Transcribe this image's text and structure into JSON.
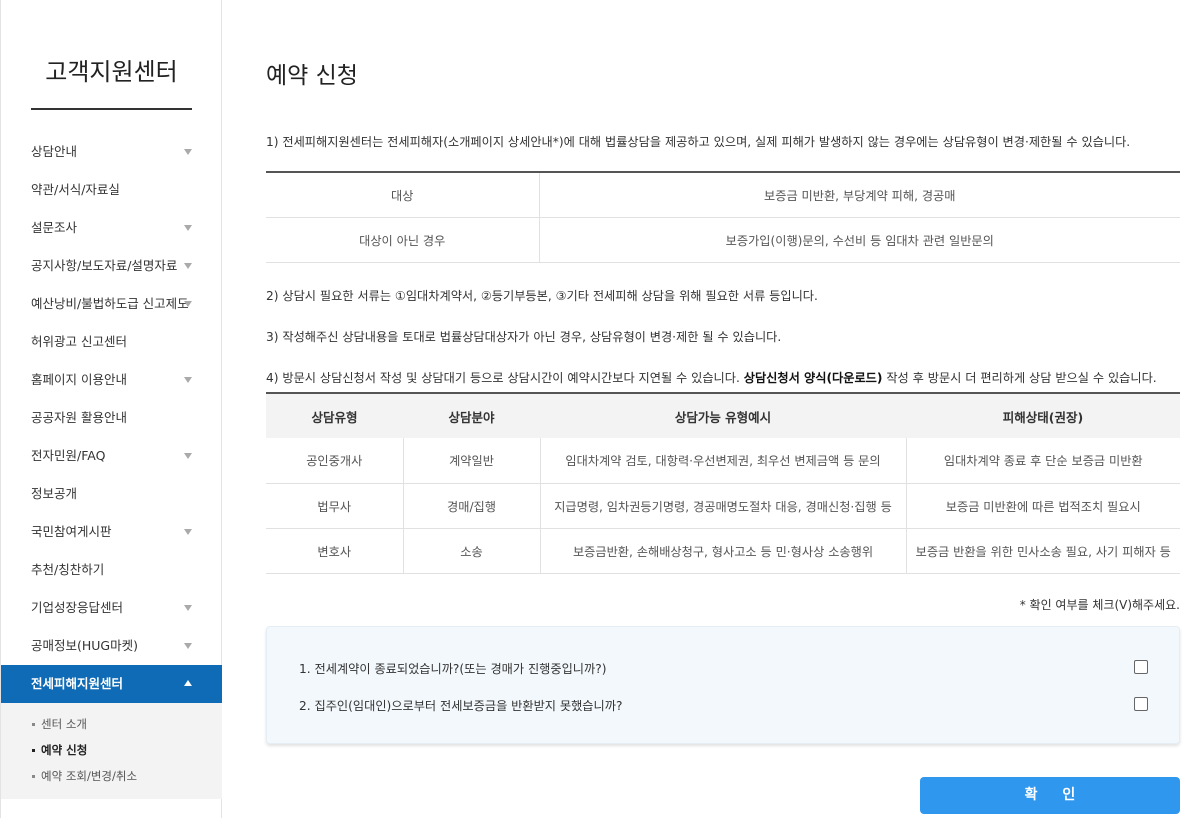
{
  "sidebar": {
    "title": "고객지원센터",
    "items": [
      {
        "label": "상담안내",
        "arrow": true
      },
      {
        "label": "약관/서식/자료실",
        "arrow": false
      },
      {
        "label": "설문조사",
        "arrow": true
      },
      {
        "label": "공지사항/보도자료/설명자료",
        "arrow": true
      },
      {
        "label": "예산낭비/불법하도급 신고제도",
        "arrow": true
      },
      {
        "label": "허위광고 신고센터",
        "arrow": false
      },
      {
        "label": "홈페이지 이용안내",
        "arrow": true
      },
      {
        "label": "공공자원 활용안내",
        "arrow": false
      },
      {
        "label": "전자민원/FAQ",
        "arrow": true
      },
      {
        "label": "정보공개",
        "arrow": false
      },
      {
        "label": "국민참여게시판",
        "arrow": true
      },
      {
        "label": "추천/칭찬하기",
        "arrow": false
      },
      {
        "label": "기업성장응답센터",
        "arrow": true
      },
      {
        "label": "공매정보(HUG마켓)",
        "arrow": true
      },
      {
        "label": "전세피해지원센터",
        "arrow": true,
        "active": true
      }
    ],
    "subitems": [
      "센터 소개",
      "예약 신청",
      "예약 조회/변경/취소"
    ],
    "current_sub": "예약 신청"
  },
  "main": {
    "title": "예약 신청",
    "note1": "1) 전세피해지원센터는 전세피해자(소개페이지 상세안내*)에 대해 법률상담을 제공하고 있으며, 실제 피해가 발생하지 않는 경우에는 상담유형이 변경·제한될 수 있습니다.",
    "table1": [
      {
        "label": "대상",
        "value": "보증금 미반환, 부당계약 피해, 경공매"
      },
      {
        "label": "대상이 아닌 경우",
        "value": "보증가입(이행)문의, 수선비 등 임대차 관련 일반문의"
      }
    ],
    "note2": "2) 상담시 필요한 서류는 ①임대차계약서, ②등기부등본, ③기타 전세피해 상담을 위해 필요한 서류 등입니다.",
    "note3": "3) 작성해주신 상담내용을 토대로 법률상담대상자가 아닌 경우, 상담유형이 변경·제한 될 수 있습니다.",
    "note4_pre": "4) 방문시 상담신청서 작성 및 상담대기 등으로 상담시간이 예약시간보다 지연될 수 있습니다. ",
    "note4_bold": "상담신청서 양식(다운로드)",
    "note4_post": " 작성 후 방문시 더 편리하게 상담 받으실 수 있습니다.",
    "table2": {
      "headers": [
        "상담유형",
        "상담분야",
        "상담가능 유형예시",
        "피해상태(권장)"
      ],
      "rows": [
        [
          "공인중개사",
          "계약일반",
          "임대차계약 검토, 대항력·우선변제권, 최우선 변제금액 등 문의",
          "임대차계약 종료 후 단순 보증금 미반환"
        ],
        [
          "법무사",
          "경매/집행",
          "지급명령, 임차권등기명령, 경공매명도절차 대응, 경매신청·집행 등",
          "보증금 미반환에 따른 법적조치 필요시"
        ],
        [
          "변호사",
          "소송",
          "보증금반환, 손해배상청구, 형사고소 등 민·형사상 소송행위",
          "보증금 반환을 위한 민사소송 필요, 사기 피해자 등"
        ]
      ]
    },
    "check_note": "* 확인 여부를 체크(V)해주세요.",
    "questions": [
      "1. 전세계약이 종료되었습니까?(또는 경매가 진행중입니까?)",
      "2. 집주인(임대인)으로부터 전세보증금을 반환받지 못했습니까?"
    ],
    "confirm_label": "확 인"
  }
}
